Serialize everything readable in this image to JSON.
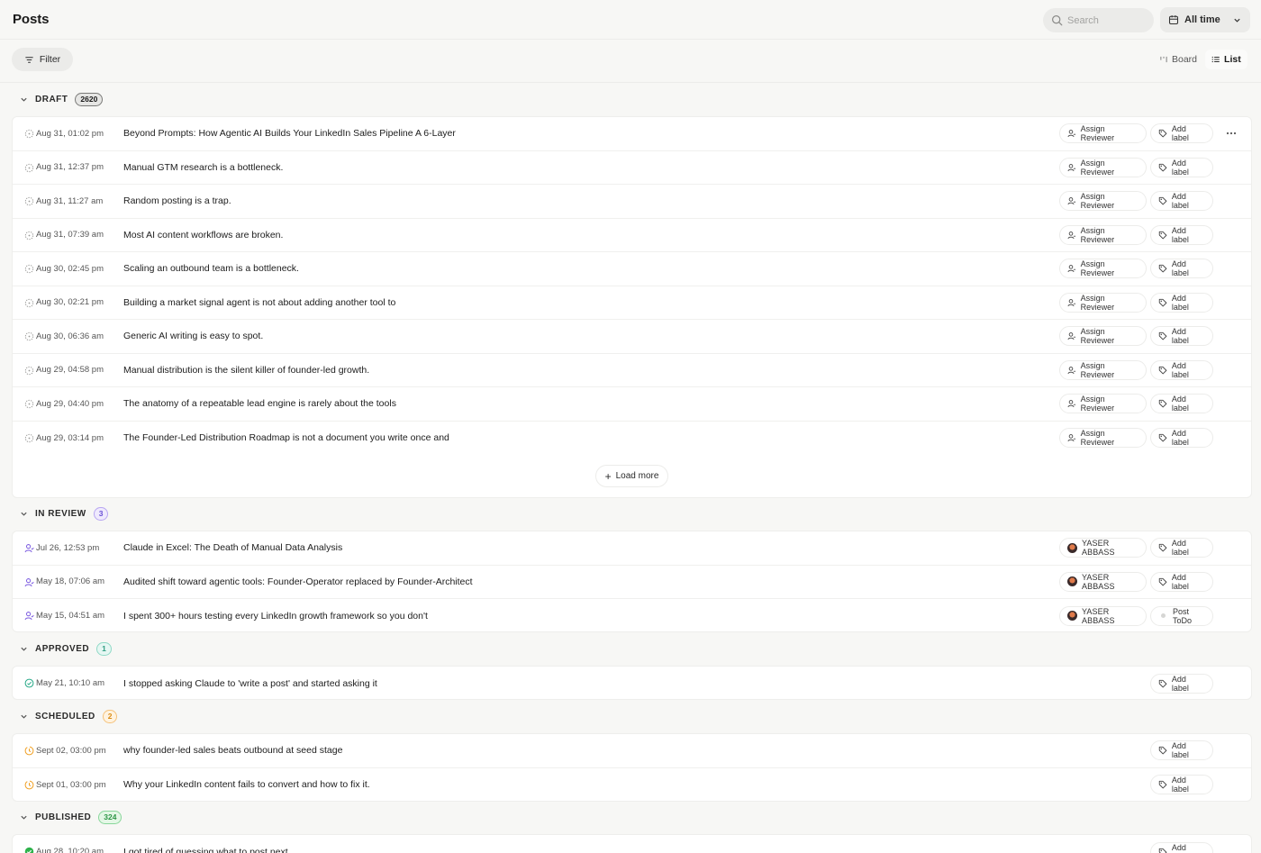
{
  "header": {
    "title": "Posts",
    "search_placeholder": "Search",
    "time_filter": "All time"
  },
  "toolbar": {
    "filter_label": "Filter",
    "board_label": "Board",
    "list_label": "List"
  },
  "actions": {
    "assign_reviewer": "Assign Reviewer",
    "add_label": "Add label",
    "load_more": "Load more"
  },
  "sections": {
    "draft": {
      "title": "DRAFT",
      "count": "2620",
      "rows": [
        {
          "date": "Aug 31, 01:02 pm",
          "title": "Beyond Prompts: How Agentic AI Builds Your LinkedIn Sales Pipeline A 6-Layer"
        },
        {
          "date": "Aug 31, 12:37 pm",
          "title": "Manual GTM research is a bottleneck."
        },
        {
          "date": "Aug 31, 11:27 am",
          "title": "Random posting is a trap."
        },
        {
          "date": "Aug 31, 07:39 am",
          "title": "Most AI content workflows are broken."
        },
        {
          "date": "Aug 30, 02:45 pm",
          "title": "Scaling an outbound team is a bottleneck."
        },
        {
          "date": "Aug 30, 02:21 pm",
          "title": "Building a market signal agent is not about adding another tool to"
        },
        {
          "date": "Aug 30, 06:36 am",
          "title": "Generic AI writing is easy to spot."
        },
        {
          "date": "Aug 29, 04:58 pm",
          "title": "Manual distribution is the silent killer of founder-led growth."
        },
        {
          "date": "Aug 29, 04:40 pm",
          "title": "The anatomy of a repeatable lead engine is rarely about the tools"
        },
        {
          "date": "Aug 29, 03:14 pm",
          "title": "The Founder-Led Distribution Roadmap is not a document you write once and"
        }
      ]
    },
    "in_review": {
      "title": "IN REVIEW",
      "count": "3",
      "rows": [
        {
          "date": "Jul 26, 12:53 pm",
          "title": "Claude in Excel: The Death of Manual Data Analysis",
          "reviewer": "YASER ABBASS",
          "label": "Add label"
        },
        {
          "date": "May 18, 07:06 am",
          "title": "Audited shift toward agentic tools: Founder-Operator replaced by Founder-Architect",
          "reviewer": "YASER ABBASS",
          "label": "Add label"
        },
        {
          "date": "May 15, 04:51 am",
          "title": "I spent 300+ hours testing every LinkedIn growth framework so you don't",
          "reviewer": "YASER ABBASS",
          "label": "Post ToDo"
        }
      ]
    },
    "approved": {
      "title": "APPROVED",
      "count": "1",
      "rows": [
        {
          "date": "May 21, 10:10 am",
          "title": "I stopped asking Claude to 'write a post' and started asking it"
        }
      ]
    },
    "scheduled": {
      "title": "SCHEDULED",
      "count": "2",
      "rows": [
        {
          "date": "Sept 02, 03:00 pm",
          "title": "why founder-led sales beats outbound at seed stage"
        },
        {
          "date": "Sept 01, 03:00 pm",
          "title": "Why your LinkedIn content fails to convert and how to fix it."
        }
      ]
    },
    "published": {
      "title": "PUBLISHED",
      "count": "324",
      "rows": [
        {
          "date": "Aug 28, 10:20 am",
          "title": "I got tired of guessing what to post next"
        }
      ]
    }
  },
  "colors": {
    "review": "#7c5ce0",
    "approved": "#25a886",
    "scheduled": "#f0a024",
    "published": "#2fb24c"
  }
}
